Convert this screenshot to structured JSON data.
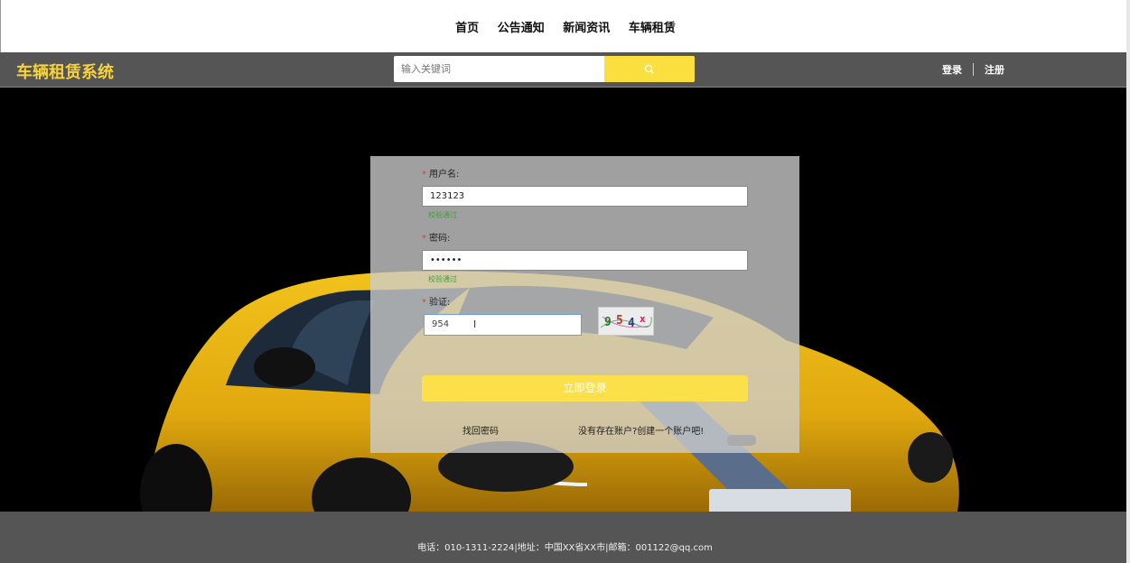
{
  "nav": {
    "items": [
      "首页",
      "公告通知",
      "新闻资讯",
      "车辆租赁"
    ]
  },
  "header": {
    "brand": "车辆租赁系统",
    "search_placeholder": "输入关键词",
    "login": "登录",
    "register": "注册"
  },
  "form": {
    "username_label": "用户名:",
    "username_value": "123123",
    "username_status": "校验通过",
    "password_label": "密码:",
    "password_value": "••••••",
    "password_status": "校验通过",
    "captcha_label": "验证:",
    "captcha_value": "954",
    "captcha_text": "954x",
    "login_button": "立即登录",
    "forgot_link": "找回密码",
    "register_link": "没有存在账户?创建一个账户吧!"
  },
  "footer": {
    "text": "电话：010-1311-2224|地址：中国XX省XX市|邮箱：001122@qq.com"
  },
  "colors": {
    "accent": "#fadf3e",
    "brand": "#f7d23a",
    "bar": "#555555"
  }
}
